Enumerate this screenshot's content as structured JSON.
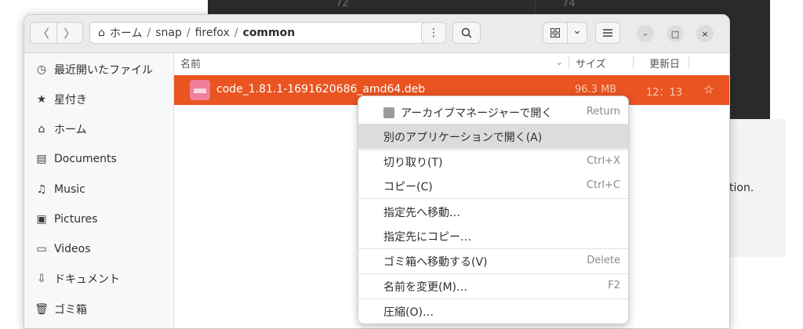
{
  "background_window": {
    "numbers": [
      "72",
      "74"
    ],
    "trailing_text": "tion."
  },
  "header": {
    "back_icon": "chevron-left-icon",
    "forward_icon": "chevron-right-icon",
    "path": {
      "home_icon": "home-icon",
      "segments": [
        "ホーム",
        "snap",
        "firefox",
        "common"
      ],
      "separator": "/"
    },
    "menu_dots": "⋮",
    "search_icon": "search-icon",
    "view_icon": "grid-icon",
    "view_dropdown": "⌄",
    "menu_icon": "hamburger-icon",
    "window_controls": [
      "–",
      "□",
      "×"
    ]
  },
  "sidebar": {
    "items": [
      {
        "icon": "recent-icon",
        "label": "最近開いたファイル"
      },
      {
        "icon": "star-icon",
        "label": "星付き"
      },
      {
        "icon": "home-icon",
        "label": "ホーム"
      },
      {
        "icon": "document-icon",
        "label": "Documents"
      },
      {
        "icon": "music-icon",
        "label": "Music"
      },
      {
        "icon": "picture-icon",
        "label": "Pictures"
      },
      {
        "icon": "video-icon",
        "label": "Videos"
      },
      {
        "icon": "download-icon",
        "label": "ドキュメント"
      },
      {
        "icon": "trash-icon",
        "label": "ゴミ箱"
      }
    ]
  },
  "list": {
    "columns": {
      "name": "名前",
      "size": "サイズ",
      "modified": "更新日"
    },
    "files": [
      {
        "name": "code_1.81.1-1691620686_amd64.deb",
        "size": "96.3 MB",
        "modified": "12：13",
        "starred": "☆"
      }
    ]
  },
  "context_menu": {
    "items": [
      {
        "label": "アーカイブマネージャーで開く",
        "shortcut": "Return",
        "icon": "archive-icon"
      },
      {
        "label": "別のアプリケーションで開く(A)",
        "shortcut": ""
      },
      {
        "label": "切り取り(T)",
        "shortcut": "Ctrl+X"
      },
      {
        "label": "コピー(C)",
        "shortcut": "Ctrl+C"
      },
      {
        "label": "指定先へ移動…",
        "shortcut": ""
      },
      {
        "label": "指定先にコピー…",
        "shortcut": ""
      },
      {
        "label": "ゴミ箱へ移動する(V)",
        "shortcut": "Delete"
      },
      {
        "label": "名前を変更(M)…",
        "shortcut": "F2"
      },
      {
        "label": "圧縮(O)…",
        "shortcut": ""
      }
    ]
  },
  "colors": {
    "accent": "#e95420",
    "highlight": "#dcdcdc"
  }
}
